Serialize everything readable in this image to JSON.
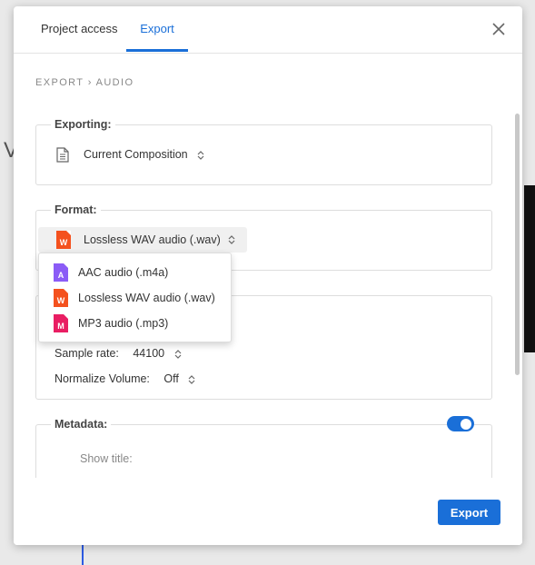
{
  "tabs": [
    {
      "label": "Project access"
    },
    {
      "label": "Export"
    }
  ],
  "breadcrumb": "EXPORT › AUDIO",
  "exporting": {
    "legend": "Exporting:",
    "value": "Current Composition",
    "icon": "document-icon"
  },
  "format": {
    "legend": "Format:",
    "selected": "Lossless WAV audio (.wav)",
    "selected_letter": "W",
    "options": [
      {
        "label": "AAC audio (.m4a)",
        "letter": "A",
        "color": "#8b5cf6"
      },
      {
        "label": "Lossless WAV audio (.wav)",
        "letter": "W",
        "color": "#f4511e"
      },
      {
        "label": "MP3 audio (.mp3)",
        "letter": "M",
        "color": "#e91e63"
      }
    ]
  },
  "settings": {
    "sample_rate_label": "Sample rate:",
    "sample_rate_value": "44100",
    "normalize_label": "Normalize Volume:",
    "normalize_value": "Off"
  },
  "metadata": {
    "legend": "Metadata:",
    "enabled": true,
    "show_title_label": "Show title:"
  },
  "footer": {
    "export_label": "Export"
  },
  "colors": {
    "accent": "#1a6fd8",
    "wav": "#f4511e",
    "aac": "#8b5cf6",
    "mp3": "#e91e63"
  }
}
